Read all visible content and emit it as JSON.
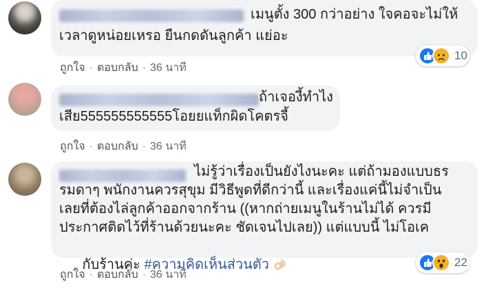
{
  "comments": [
    {
      "text_lines": [
        "เมนูตั้ง 300 กว่าอย่าง ใจคอจะไม่ให้",
        "เวลาดูหน่อยเหรอ ยืนกดดันลูกค้า แย่อะ"
      ],
      "actions": {
        "like": "ถูกใจ",
        "reply": "ตอบกลับ",
        "time": "36 นาที"
      },
      "reactions": {
        "icons": [
          "like-icon",
          "sad-icon"
        ],
        "count": "10"
      }
    },
    {
      "text_lines": [
        "ถ้าเจองี้ทำไง",
        "เสีย555555555555โอยยแท็กผิดโคตรจี้"
      ],
      "actions": {
        "like": "ถูกใจ",
        "reply": "ตอบกลับ",
        "time": "36 นาที"
      }
    },
    {
      "text_lines": [
        "ไม่รู้ว่าเรื่องเป็นยังไงนะคะ แต่ถ้ามองแบบธร",
        "รมดาๆ พนักงานควรสุขุม มีวิธีพูดที่ดีกว่านี้ และเรื่องแค่นี้ไม่จำเป็น",
        "เลยที่ต้องไล่ลูกค้าออกจากร้าน ((หากถ่ายเมนูในร้านไม่ได้ ควรมี",
        "ประกาศติดไว้ที่ร้านด้วยนะคะ ชัดเจนไปเลย)) แต่แบบนี้ ไม่โอเค",
        "กับร้านค่ะ"
      ],
      "hashtag": "#ความคิดเห็นส่วนตัว",
      "emoji": "ok-hand-icon",
      "actions": {
        "like": "ถูกใจ",
        "reply": "ตอบกลับ",
        "time": "36 นาที"
      },
      "reactions": {
        "icons": [
          "like-icon",
          "wow-icon"
        ],
        "count": "22"
      }
    }
  ],
  "colors": {
    "bubble": "#f2f3f5",
    "text": "#1c1e21",
    "meta": "#65676b",
    "hashtag": "#385898",
    "like": "#1877f2",
    "emoji_yellow": "#f7b125"
  }
}
